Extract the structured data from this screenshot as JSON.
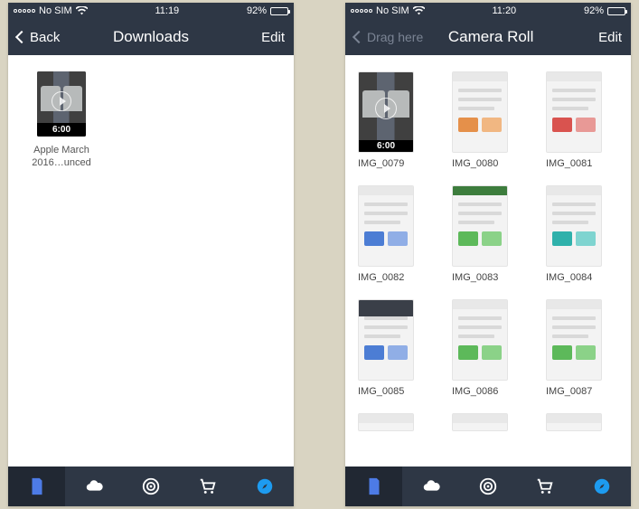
{
  "left": {
    "status": {
      "carrier": "No SIM",
      "time": "11:19",
      "battery": "92%"
    },
    "nav": {
      "back": "Back",
      "title": "Downloads",
      "edit": "Edit"
    },
    "item": {
      "duration": "6:00",
      "name": "Apple March 2016…unced"
    }
  },
  "right": {
    "status": {
      "carrier": "No SIM",
      "time": "11:20",
      "battery": "92%"
    },
    "nav": {
      "drag": "Drag here",
      "title": "Camera Roll",
      "edit": "Edit"
    },
    "items": [
      {
        "name": "IMG_0079",
        "kind": "video",
        "duration": "6:00"
      },
      {
        "name": "IMG_0080",
        "kind": "shot",
        "tint": "c-orange"
      },
      {
        "name": "IMG_0081",
        "kind": "shot",
        "tint": "c-red"
      },
      {
        "name": "IMG_0082",
        "kind": "shot",
        "tint": "c-blue"
      },
      {
        "name": "IMG_0083",
        "kind": "shot",
        "tint": "c-green",
        "topbar": "green"
      },
      {
        "name": "IMG_0084",
        "kind": "shot",
        "tint": "c-teal"
      },
      {
        "name": "IMG_0085",
        "kind": "shot",
        "tint": "c-blue",
        "topbar": "dark"
      },
      {
        "name": "IMG_0086",
        "kind": "shot",
        "tint": "c-green"
      },
      {
        "name": "IMG_0087",
        "kind": "shot",
        "tint": "c-green"
      }
    ],
    "more_row_visible": true
  },
  "toolbar_icons": [
    "doc",
    "cloud",
    "hotspot",
    "cart",
    "compass"
  ]
}
